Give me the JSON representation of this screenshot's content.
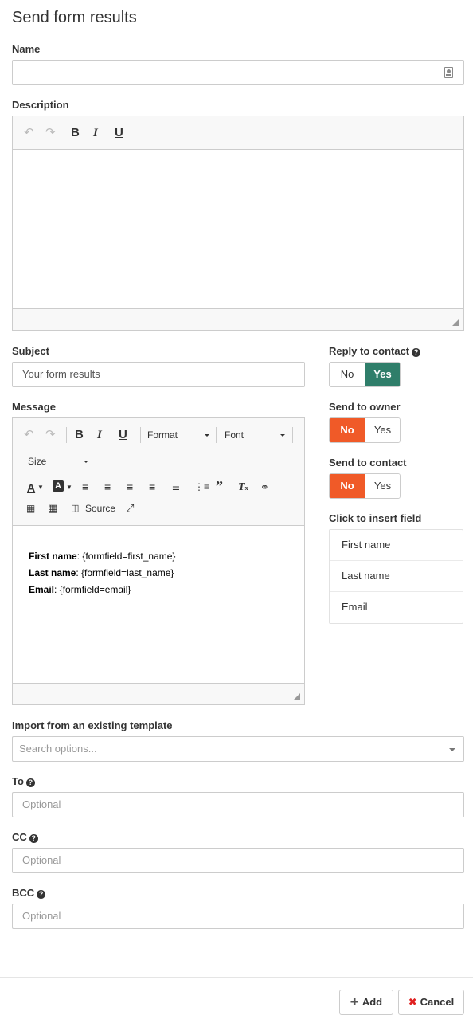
{
  "page": {
    "title": "Send form results"
  },
  "name": {
    "label": "Name",
    "value": ""
  },
  "description": {
    "label": "Description"
  },
  "subject": {
    "label": "Subject",
    "value": "Your form results"
  },
  "reply_to_contact": {
    "label": "Reply to contact",
    "no": "No",
    "yes": "Yes",
    "selected": "Yes"
  },
  "send_to_owner": {
    "label": "Send to owner",
    "no": "No",
    "yes": "Yes",
    "selected": "No"
  },
  "send_to_contact": {
    "label": "Send to contact",
    "no": "No",
    "yes": "Yes",
    "selected": "No"
  },
  "message": {
    "label": "Message",
    "toolbar": {
      "format": "Format",
      "font": "Font",
      "size": "Size",
      "source": "Source"
    },
    "lines": [
      {
        "key": "First name",
        "value": ": {formfield=first_name}"
      },
      {
        "key": "Last name",
        "value": ": {formfield=last_name}"
      },
      {
        "key": "Email",
        "value": ": {formfield=email}"
      }
    ]
  },
  "insert_field": {
    "label": "Click to insert field",
    "items": [
      "First name",
      "Last name",
      "Email"
    ]
  },
  "template": {
    "label": "Import from an existing template",
    "placeholder": "Search options..."
  },
  "to": {
    "label": "To",
    "placeholder": "Optional"
  },
  "cc": {
    "label": "CC",
    "placeholder": "Optional"
  },
  "bcc": {
    "label": "BCC",
    "placeholder": "Optional"
  },
  "actions": {
    "add": "Add",
    "cancel": "Cancel"
  },
  "icons": {
    "help": "question-circle-icon",
    "contact_card": "contact-card-icon",
    "add": "plus-icon",
    "cancel": "times-icon"
  },
  "colors": {
    "no_active": "#f05a28",
    "yes_active": "#2f7e6a",
    "cancel_icon": "#e02020"
  }
}
